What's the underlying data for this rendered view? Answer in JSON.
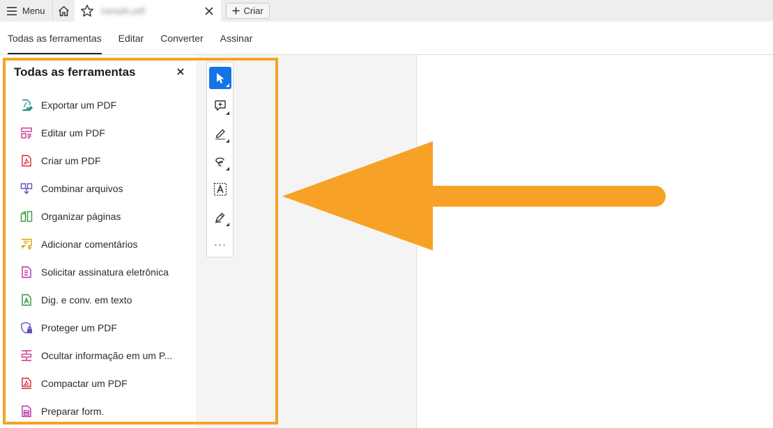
{
  "titlebar": {
    "menu_label": "Menu",
    "doc_name": "sample.pdf",
    "create_label": "Criar"
  },
  "tabs": [
    {
      "label": "Todas as ferramentas",
      "active": true
    },
    {
      "label": "Editar",
      "active": false
    },
    {
      "label": "Converter",
      "active": false
    },
    {
      "label": "Assinar",
      "active": false
    }
  ],
  "panel": {
    "title": "Todas as ferramentas",
    "tools": [
      {
        "label": "Exportar um PDF",
        "icon": "export-pdf-icon",
        "color": "#1b8a7a"
      },
      {
        "label": "Editar um PDF",
        "icon": "edit-pdf-icon",
        "color": "#c8338f"
      },
      {
        "label": "Criar um PDF",
        "icon": "create-pdf-icon",
        "color": "#d4262b"
      },
      {
        "label": "Combinar arquivos",
        "icon": "combine-files-icon",
        "color": "#5a4fc4"
      },
      {
        "label": "Organizar páginas",
        "icon": "organize-pages-icon",
        "color": "#3a9a3a"
      },
      {
        "label": "Adicionar comentários",
        "icon": "add-comment-icon",
        "color": "#d8a400"
      },
      {
        "label": "Solicitar assinatura eletrônica",
        "icon": "request-signature-icon",
        "color": "#b52ea6"
      },
      {
        "label": "Dig. e conv. em texto",
        "icon": "scan-ocr-icon",
        "color": "#2d8f3d"
      },
      {
        "label": "Proteger um PDF",
        "icon": "protect-pdf-icon",
        "color": "#5a4fc4"
      },
      {
        "label": "Ocultar informação em um P...",
        "icon": "redact-icon",
        "color": "#c8338f"
      },
      {
        "label": "Compactar um PDF",
        "icon": "compress-pdf-icon",
        "color": "#d4262b"
      },
      {
        "label": "Preparar form.",
        "icon": "prepare-form-icon",
        "color": "#b52ea6"
      }
    ]
  },
  "quick_tools": [
    {
      "name": "select-tool",
      "icon": "cursor-arrow-icon",
      "active": true
    },
    {
      "name": "add-comment-tool",
      "icon": "comment-plus-icon",
      "active": false
    },
    {
      "name": "highlight-tool",
      "icon": "highlighter-icon",
      "active": false
    },
    {
      "name": "draw-tool",
      "icon": "freehand-draw-icon",
      "active": false
    },
    {
      "name": "text-select-tool",
      "icon": "text-box-icon",
      "active": false
    },
    {
      "name": "sign-tool",
      "icon": "pen-sign-icon",
      "active": false
    },
    {
      "name": "more-tools",
      "icon": "more-dots-icon",
      "active": false
    }
  ],
  "colors": {
    "accent": "#1473e6",
    "highlight": "#f7a226"
  },
  "annotation": {
    "type": "arrow",
    "color": "#f7a226",
    "direction": "left"
  }
}
